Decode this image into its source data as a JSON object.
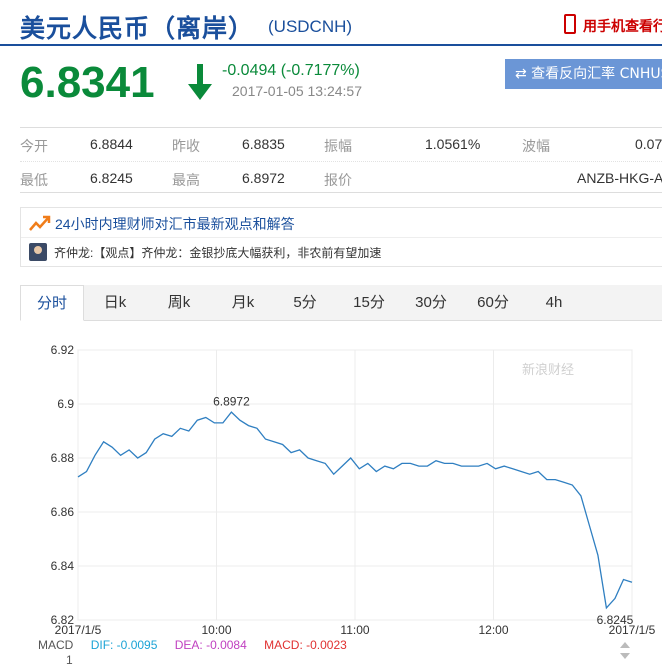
{
  "header": {
    "title": "美元人民币（离岸）",
    "code": "(USDCNH)",
    "mobile_link": "用手机查看行"
  },
  "quote": {
    "price": "6.8341",
    "change": "-0.0494 (-0.7177%)",
    "time": "2017-01-05 13:24:57",
    "reverse_button": "⇄ 查看反向汇率 CNHUSD"
  },
  "stats": {
    "row1": [
      {
        "label": "今开",
        "value": "6.8844"
      },
      {
        "label": "昨收",
        "value": "6.8835"
      },
      {
        "label": "振幅",
        "value": "1.0561%"
      },
      {
        "label": "波幅",
        "value": "0.07"
      }
    ],
    "row2": [
      {
        "label": "最低",
        "value": "6.8245"
      },
      {
        "label": "最高",
        "value": "6.8972"
      },
      {
        "label": "报价",
        "value": "ANZB-HKG-A"
      }
    ]
  },
  "news": {
    "headline": "24小时内理财师对汇市最新观点和解答",
    "item": "齐仲龙:【观点】齐仲龙：金银抄底大幅获利，非农前有望加速"
  },
  "tabs": [
    "分时",
    "日k",
    "周k",
    "月k",
    "5分",
    "15分",
    "30分",
    "60分",
    "4h"
  ],
  "colors": {
    "brand": "#1a4f9c",
    "down": "#0a8a3a",
    "line": "#2f7fc1"
  },
  "chart_data": {
    "type": "line",
    "watermark": "新浪财经",
    "x_tick_labels": [
      "2017/1/5",
      "10:00",
      "11:00",
      "12:00",
      "2017/1/5"
    ],
    "y_tick_labels": [
      "6.92",
      "6.9",
      "6.88",
      "6.86",
      "6.84",
      "6.82"
    ],
    "ylim": [
      6.82,
      6.92
    ],
    "grid": true,
    "annotations": [
      {
        "text": "6.8972",
        "x": 36,
        "y": 6.8972
      },
      {
        "text": "6.8245",
        "x": 126,
        "y": 6.8245
      }
    ],
    "series": [
      {
        "x": [
          0,
          2,
          4,
          6,
          8,
          10,
          12,
          14,
          16,
          18,
          20,
          22,
          24,
          26,
          28,
          30,
          32,
          34,
          36,
          38,
          40,
          42,
          44,
          46,
          48,
          50,
          52,
          54,
          56,
          58,
          60,
          62,
          64,
          66,
          68,
          70,
          72,
          74,
          76,
          78,
          80,
          82,
          84,
          86,
          88,
          90,
          92,
          94,
          96,
          98,
          100,
          102,
          104,
          106,
          108,
          110,
          112,
          114,
          116,
          118,
          120,
          122,
          124,
          126,
          128,
          130
        ],
        "y": [
          6.873,
          6.875,
          6.881,
          6.886,
          6.884,
          6.881,
          6.883,
          6.88,
          6.882,
          6.887,
          6.889,
          6.888,
          6.891,
          6.89,
          6.894,
          6.895,
          6.893,
          6.893,
          6.897,
          6.894,
          6.892,
          6.891,
          6.887,
          6.886,
          6.885,
          6.882,
          6.883,
          6.88,
          6.879,
          6.878,
          6.874,
          6.877,
          6.88,
          6.876,
          6.878,
          6.875,
          6.877,
          6.876,
          6.878,
          6.878,
          6.877,
          6.877,
          6.879,
          6.878,
          6.878,
          6.877,
          6.877,
          6.877,
          6.878,
          6.876,
          6.877,
          6.876,
          6.875,
          6.874,
          6.875,
          6.872,
          6.872,
          6.871,
          6.87,
          6.866,
          6.855,
          6.844,
          6.8245,
          6.828,
          6.835,
          6.834
        ]
      }
    ]
  },
  "macd": {
    "label": "MACD",
    "dif": "DIF: -0.0095",
    "dea": "DEA: -0.0084",
    "macd": "MACD: -0.0023",
    "axis_value": "1"
  }
}
